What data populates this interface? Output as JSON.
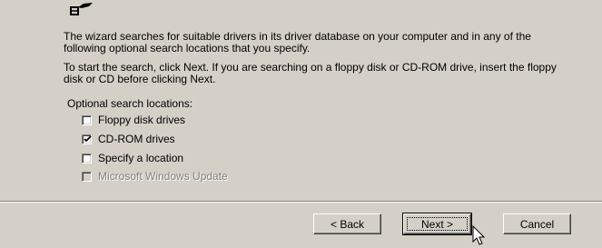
{
  "wizard": {
    "paragraph1": "The wizard searches for suitable drivers in its driver database on your computer and in any of the following optional search locations that you specify.",
    "paragraph2": "To start the search, click Next. If you are searching on a floppy disk or CD-ROM drive, insert the floppy disk or CD before clicking Next.",
    "options_label": "Optional search locations:",
    "options": [
      {
        "label": "Floppy disk drives",
        "checked": false,
        "enabled": true
      },
      {
        "label": "CD-ROM drives",
        "checked": true,
        "enabled": true
      },
      {
        "label": "Specify a location",
        "checked": false,
        "enabled": true
      },
      {
        "label": "Microsoft Windows Update",
        "checked": false,
        "enabled": false
      }
    ]
  },
  "buttons": {
    "back": "< Back",
    "next": "Next >",
    "cancel": "Cancel"
  },
  "icons": {
    "hardware": "hardware-icon",
    "cursor": "mouse-pointer-icon"
  }
}
